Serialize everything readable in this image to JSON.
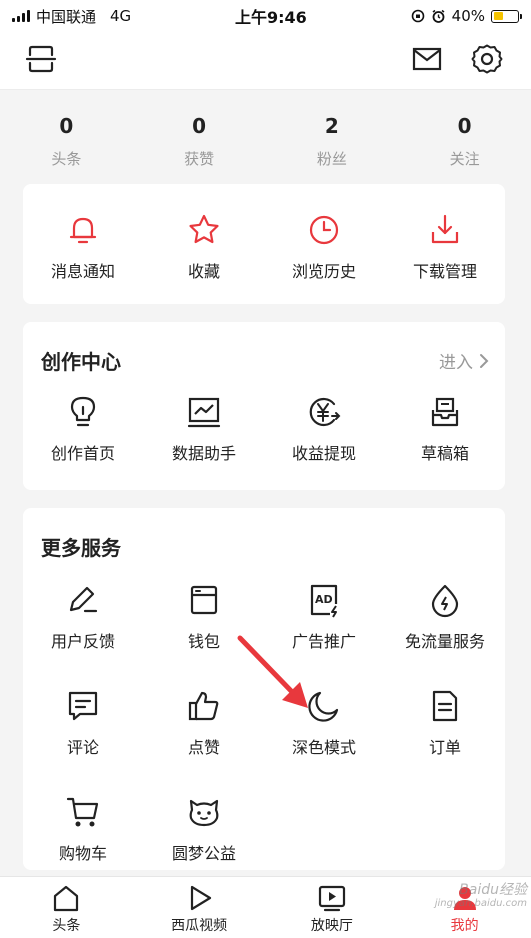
{
  "status_bar": {
    "carrier": "中国联通",
    "network": "4G",
    "time": "上午9:46",
    "battery_percent": "40%",
    "battery_level": 0.4
  },
  "header": {
    "icons": [
      "scan-icon",
      "mail-icon",
      "gear-icon"
    ]
  },
  "stats": [
    {
      "value": "0",
      "label": "头条"
    },
    {
      "value": "0",
      "label": "获赞"
    },
    {
      "value": "2",
      "label": "粉丝"
    },
    {
      "value": "0",
      "label": "关注"
    }
  ],
  "quick_actions": [
    {
      "label": "消息通知",
      "icon": "bell-icon"
    },
    {
      "label": "收藏",
      "icon": "star-icon"
    },
    {
      "label": "浏览历史",
      "icon": "clock-icon"
    },
    {
      "label": "下载管理",
      "icon": "download-icon"
    }
  ],
  "creation_center": {
    "title": "创作中心",
    "enter_label": "进入",
    "items": [
      {
        "label": "创作首页",
        "icon": "lightbulb-icon"
      },
      {
        "label": "数据助手",
        "icon": "chart-icon"
      },
      {
        "label": "收益提现",
        "icon": "yen-icon"
      },
      {
        "label": "草稿箱",
        "icon": "drafts-icon"
      }
    ]
  },
  "more_services": {
    "title": "更多服务",
    "items": [
      {
        "label": "用户反馈",
        "icon": "pen-icon"
      },
      {
        "label": "钱包",
        "icon": "wallet-icon"
      },
      {
        "label": "广告推广",
        "icon": "ad-icon"
      },
      {
        "label": "免流量服务",
        "icon": "drop-icon"
      },
      {
        "label": "评论",
        "icon": "comment-icon"
      },
      {
        "label": "点赞",
        "icon": "thumbs-up-icon"
      },
      {
        "label": "深色模式",
        "icon": "moon-icon"
      },
      {
        "label": "订单",
        "icon": "order-icon"
      },
      {
        "label": "购物车",
        "icon": "cart-icon"
      },
      {
        "label": "圆梦公益",
        "icon": "charity-icon"
      }
    ]
  },
  "bottom_nav": [
    {
      "label": "头条",
      "icon": "home-icon",
      "active": false
    },
    {
      "label": "西瓜视频",
      "icon": "play-icon",
      "active": false
    },
    {
      "label": "放映厅",
      "icon": "video-icon",
      "active": false
    },
    {
      "label": "我的",
      "icon": "profile-icon",
      "active": true
    }
  ],
  "watermark": {
    "text": "Baidu经验",
    "sub": "jingyan.baidu.com"
  },
  "colors": {
    "accent": "#e8383d",
    "icon_dark": "#222222",
    "muted": "#999999",
    "background": "#f4f4f4"
  }
}
